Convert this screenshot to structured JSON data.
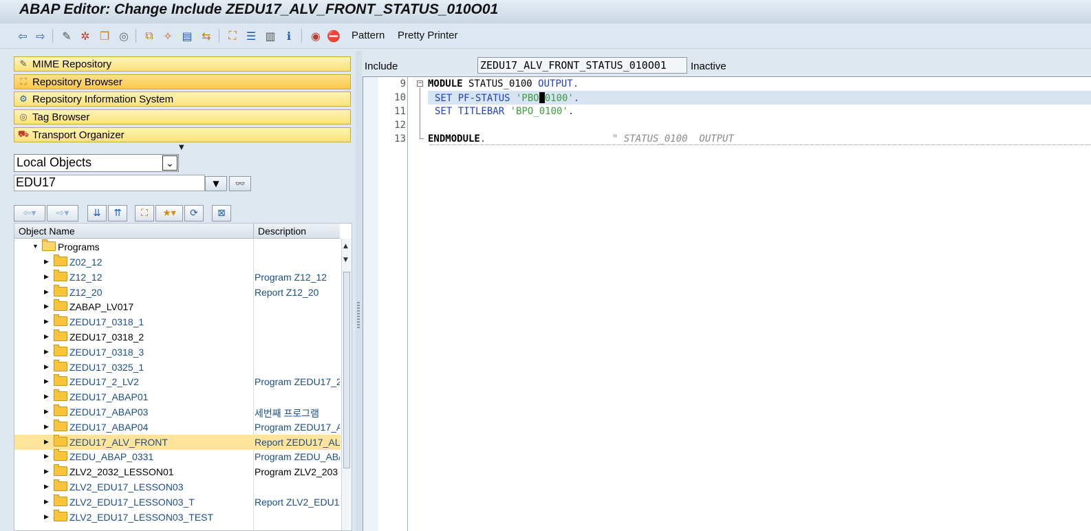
{
  "window": {
    "title": "ABAP Editor: Change Include ZEDU17_ALV_FRONT_STATUS_010O01"
  },
  "toolbar": {
    "icons": [
      "back-icon",
      "forward-icon",
      "display-change-icon",
      "activate-icon",
      "check-icon",
      "test-icon",
      "where-used-icon",
      "object-list-icon",
      "navigation-window-icon",
      "enhance-icon",
      "hierarchy-icon",
      "outline-icon",
      "split-screen-icon",
      "info-icon",
      "set-breakpoint-icon",
      "stop-icon"
    ],
    "pattern_label": "Pattern",
    "pretty_printer_label": "Pretty Printer"
  },
  "navigator": {
    "tools": [
      {
        "label": "MIME Repository",
        "icon": "mime-icon"
      },
      {
        "label": "Repository Browser",
        "icon": "hierarchy-icon"
      },
      {
        "label": "Repository Information System",
        "icon": "info-system-icon"
      },
      {
        "label": "Tag Browser",
        "icon": "tag-icon"
      },
      {
        "label": "Transport Organizer",
        "icon": "truck-icon"
      }
    ],
    "object_type": "Local Objects",
    "object_value": "EDU17"
  },
  "tree": {
    "columns": [
      "Object Name",
      "Description"
    ],
    "root": "Programs",
    "rows": [
      {
        "name": "Z02_12",
        "desc": ""
      },
      {
        "name": "Z12_12",
        "desc": "Program Z12_12"
      },
      {
        "name": "Z12_20",
        "desc": "Report Z12_20"
      },
      {
        "name": "ZABAP_LV017",
        "desc": ""
      },
      {
        "name": "ZEDU17_0318_1",
        "desc": ""
      },
      {
        "name": "ZEDU17_0318_2",
        "desc": ""
      },
      {
        "name": "ZEDU17_0318_3",
        "desc": ""
      },
      {
        "name": "ZEDU17_0325_1",
        "desc": ""
      },
      {
        "name": "ZEDU17_2_LV2",
        "desc": "Program ZEDU17_2"
      },
      {
        "name": "ZEDU17_ABAP01",
        "desc": ""
      },
      {
        "name": "ZEDU17_ABAP03",
        "desc": "세번째 프로그램"
      },
      {
        "name": "ZEDU17_ABAP04",
        "desc": "Program ZEDU17_A"
      },
      {
        "name": "ZEDU17_ALV_FRONT",
        "desc": "Report ZEDU17_AL"
      },
      {
        "name": "ZEDU_ABAP_0331",
        "desc": "Program ZEDU_AB/"
      },
      {
        "name": "ZLV2_2032_LESSON01",
        "desc": "Program ZLV2_203"
      },
      {
        "name": "ZLV2_EDU17_LESSON03",
        "desc": ""
      },
      {
        "name": "ZLV2_EDU17_LESSON03_T",
        "desc": "Report ZLV2_EDU1"
      },
      {
        "name": "ZLV2_EDU17_LESSON03_TEST",
        "desc": ""
      }
    ]
  },
  "editor": {
    "label": "Include",
    "object": "ZEDU17_ALV_FRONT_STATUS_010O01",
    "status": "Inactive",
    "lines": [
      {
        "no": "9"
      },
      {
        "no": "10"
      },
      {
        "no": "11"
      },
      {
        "no": "12"
      },
      {
        "no": "13"
      }
    ],
    "code": {
      "l9_kw": "MODULE",
      "l9_name": " STATUS_0100 ",
      "l9_kb": "OUTPUT",
      "l9_end": ".",
      "l10_kb": "SET PF-STATUS",
      "l10_str_a": " 'PBO",
      "l10_str_b": "0100'",
      "l10_end": ".",
      "l11_kb": "SET TITLEBAR",
      "l11_str": " 'BPO_0100'",
      "l11_end": ".",
      "l13_kw": "ENDMODULE",
      "l13_end": ".",
      "l13_comment": "\" STATUS_0100  OUTPUT"
    }
  }
}
